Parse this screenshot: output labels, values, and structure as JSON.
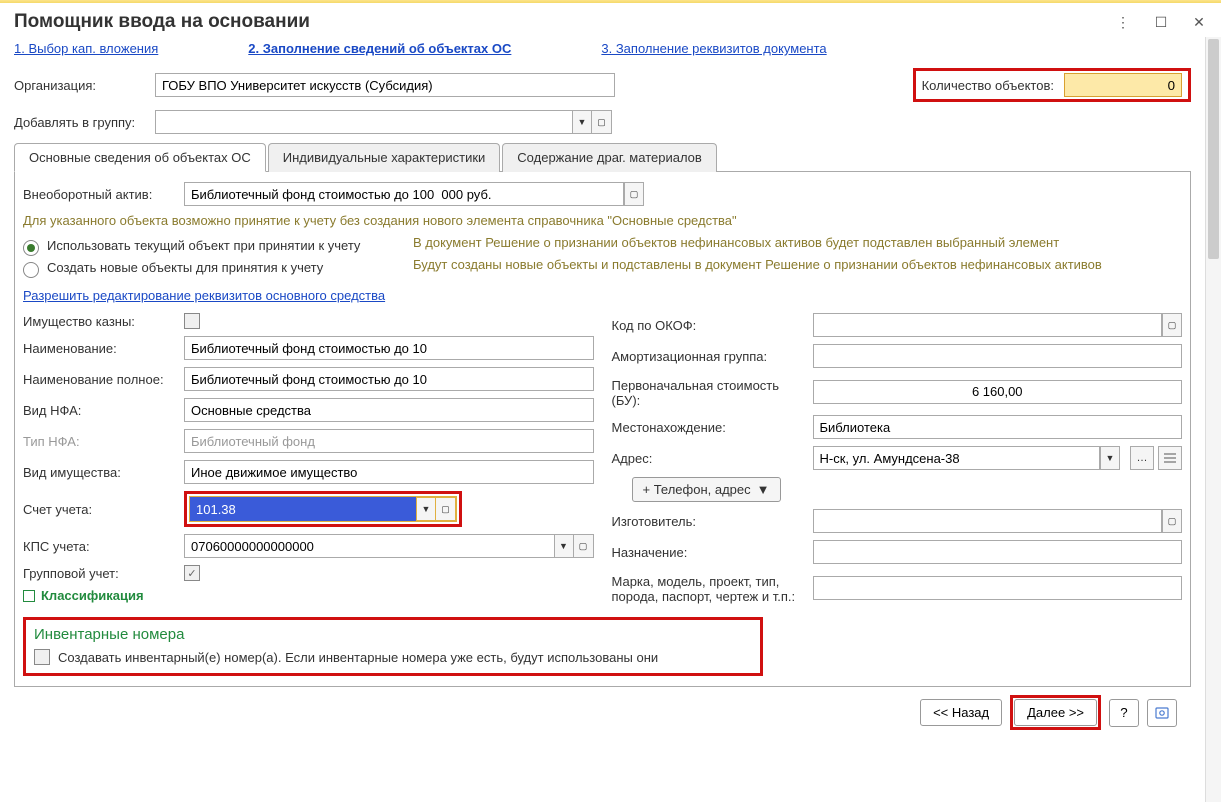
{
  "window": {
    "title": "Помощник ввода на основании"
  },
  "steps": {
    "s1": "1. Выбор кап. вложения",
    "s2": "2. Заполнение сведений об объектах ОС",
    "s3": "3. Заполнение реквизитов документа"
  },
  "top": {
    "org_label": "Организация:",
    "org_value": "ГОБУ ВПО Университет искусств (Субсидия)",
    "qty_label": "Количество объектов:",
    "qty_value": "0",
    "add_group_label": "Добавлять в группу:",
    "add_group_value": ""
  },
  "tabs": {
    "t1": "Основные сведения об объектах ОС",
    "t2": "Индивидуальные характеристики",
    "t3": "Содержание драг. материалов"
  },
  "body": {
    "asset_label": "Внеоборотный актив:",
    "asset_value": "Библиотечный фонд стоимостью до 100  000 руб.",
    "hint1": "Для указанного объекта возможно принятие к учету без создания нового элемента справочника \"Основные средства\"",
    "radio1": "Использовать текущий объект при принятии к учету",
    "radio2": "Создать новые объекты для принятия к учету",
    "desc1": "В документ Решение о признании объектов нефинансовых активов будет подставлен выбранный элемент",
    "desc2": "Будут созданы новые объекты и подставлены в документ Решение о признании объектов нефинансовых активов",
    "edit_link": "Разрешить редактирование реквизитов основного средства"
  },
  "left": {
    "treasury_label": "Имущество казны:",
    "name_label": "Наименование:",
    "name_value": "Библиотечный фонд стоимостью до 10",
    "fullname_label": "Наименование полное:",
    "fullname_value": "Библиотечный фонд стоимостью до 10",
    "nfa_label": "Вид НФА:",
    "nfa_value": "Основные средства",
    "nfa_type_label": "Тип НФА:",
    "nfa_type_value": "Библиотечный фонд",
    "prop_label": "Вид имущества:",
    "prop_value": "Иное движимое имущество",
    "account_label": "Счет учета:",
    "account_value": "101.38",
    "kps_label": "КПС учета:",
    "kps_value": "07060000000000000",
    "group_label": "Групповой учет:",
    "klass": "Классификация"
  },
  "right": {
    "okof_label": "Код по ОКОФ:",
    "amort_label": "Амортизационная группа:",
    "cost_label": "Первоначальная стоимость (БУ):",
    "cost_value": "6 160,00",
    "loc_label": "Местонахождение:",
    "loc_value": "Библиотека",
    "addr_label": "Адрес:",
    "addr_value": "Н-ск, ул. Амундсена-38",
    "phone_btn": "+ Телефон, адрес",
    "maker_label": "Изготовитель:",
    "purpose_label": "Назначение:",
    "model_label": "Марка, модель, проект, тип, порода, паспорт, чертеж и т.п.:"
  },
  "inv": {
    "title": "Инвентарные номера",
    "check_label": "Создавать инвентарный(е) номер(а). Если инвентарные номера уже есть, будут использованы они"
  },
  "footer": {
    "back": "<< Назад",
    "next": "Далее >>",
    "help": "?"
  }
}
